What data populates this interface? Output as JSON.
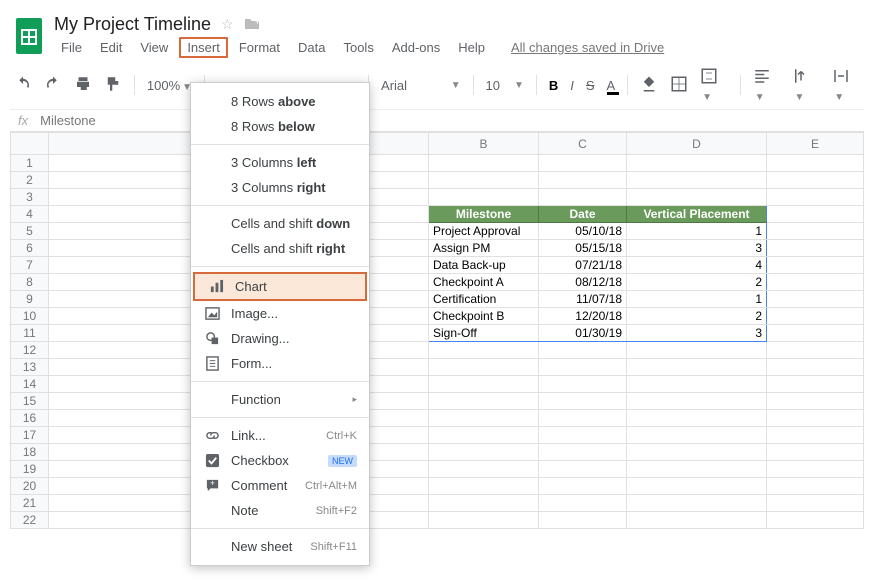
{
  "doc": {
    "title": "My Project Timeline"
  },
  "menubar": {
    "file": "File",
    "edit": "Edit",
    "view": "View",
    "insert": "Insert",
    "format": "Format",
    "data": "Data",
    "tools": "Tools",
    "addons": "Add-ons",
    "help": "Help",
    "saved": "All changes saved in Drive"
  },
  "toolbar": {
    "zoom": "100%",
    "font": "Arial",
    "size": "10"
  },
  "fx": {
    "value": "Milestone"
  },
  "cols": {
    "b": "B",
    "c": "C",
    "d": "D",
    "e": "E"
  },
  "dropdown": {
    "rows_above_pre": "8 Rows ",
    "rows_above_b": "above",
    "rows_below_pre": "8 Rows ",
    "rows_below_b": "below",
    "cols_left_pre": "3 Columns ",
    "cols_left_b": "left",
    "cols_right_pre": "3 Columns ",
    "cols_right_b": "right",
    "cells_down_pre": "Cells and shift ",
    "cells_down_b": "down",
    "cells_right_pre": "Cells and shift ",
    "cells_right_b": "right",
    "chart": "Chart",
    "image": "Image...",
    "drawing": "Drawing...",
    "form": "Form...",
    "function": "Function",
    "link": "Link...",
    "link_short": "Ctrl+K",
    "checkbox": "Checkbox",
    "checkbox_badge": "NEW",
    "comment": "Comment",
    "comment_short": "Ctrl+Alt+M",
    "note": "Note",
    "note_short": "Shift+F2",
    "newsheet": "New sheet",
    "newsheet_short": "Shift+F11"
  },
  "table": {
    "h1": "Milestone",
    "h2": "Date",
    "h3": "Vertical Placement",
    "rows": [
      {
        "m": "Project Approval",
        "d": "05/10/18",
        "v": "1"
      },
      {
        "m": "Assign PM",
        "d": "05/15/18",
        "v": "3"
      },
      {
        "m": "Data Back-up",
        "d": "07/21/18",
        "v": "4"
      },
      {
        "m": "Checkpoint A",
        "d": "08/12/18",
        "v": "2"
      },
      {
        "m": "Certification",
        "d": "11/07/18",
        "v": "1"
      },
      {
        "m": "Checkpoint B",
        "d": "12/20/18",
        "v": "2"
      },
      {
        "m": "Sign-Off",
        "d": "01/30/19",
        "v": "3"
      }
    ]
  }
}
